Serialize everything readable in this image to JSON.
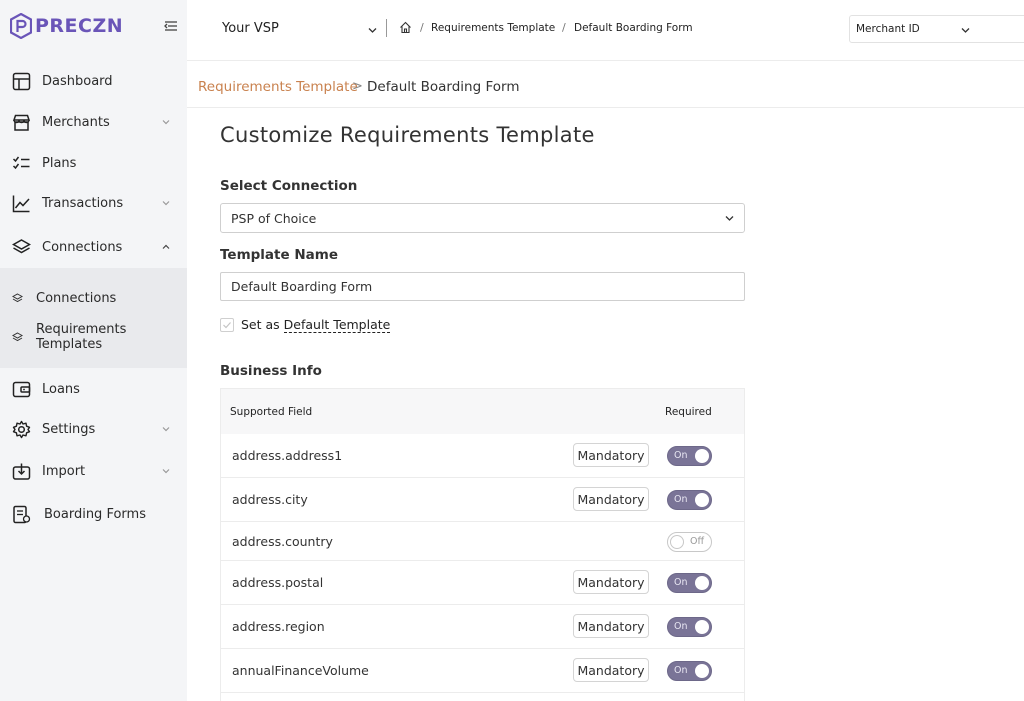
{
  "brand": {
    "name": "PRECZN",
    "color": "#6a55b8"
  },
  "sidebar": {
    "items": [
      {
        "label": "Dashboard"
      },
      {
        "label": "Merchants"
      },
      {
        "label": "Plans"
      },
      {
        "label": "Transactions"
      },
      {
        "label": "Connections"
      },
      {
        "label": "Loans"
      },
      {
        "label": "Settings"
      },
      {
        "label": "Import"
      },
      {
        "label": "Boarding Forms"
      }
    ],
    "subitems": [
      {
        "label": "Connections"
      },
      {
        "label": "Requirements Templates"
      }
    ]
  },
  "topbar": {
    "vsp_label": "Your VSP",
    "crumbs": [
      "Requirements Template",
      "Default Boarding Form"
    ],
    "merchant_label": "Merchant ID"
  },
  "breadcrumb": {
    "link": "Requirements Template",
    "separator": ">",
    "current": "Default Boarding Form",
    "link_color": "#c9824f"
  },
  "main": {
    "title": "Customize Requirements Template",
    "connection_label": "Select Connection",
    "connection_value": "PSP of Choice",
    "template_name_label": "Template Name",
    "template_name_value": "Default Boarding Form",
    "default_prefix": "Set as",
    "default_link": "Default Template",
    "section_title": "Business Info"
  },
  "table": {
    "col_field": "Supported Field",
    "col_required": "Required",
    "rows": [
      {
        "field": "address.address1",
        "tag": "Mandatory",
        "toggle": "On"
      },
      {
        "field": "address.city",
        "tag": "Mandatory",
        "toggle": "On"
      },
      {
        "field": "address.country",
        "tag": "",
        "toggle": "Off"
      },
      {
        "field": "address.postal",
        "tag": "Mandatory",
        "toggle": "On"
      },
      {
        "field": "address.region",
        "tag": "Mandatory",
        "toggle": "On"
      },
      {
        "field": "annualFinanceVolume",
        "tag": "Mandatory",
        "toggle": "On"
      }
    ]
  },
  "colors": {
    "toggle_on": "#7a7497",
    "sidebar_bg": "#f4f5f7",
    "subnav_bg": "#e9eaed"
  }
}
